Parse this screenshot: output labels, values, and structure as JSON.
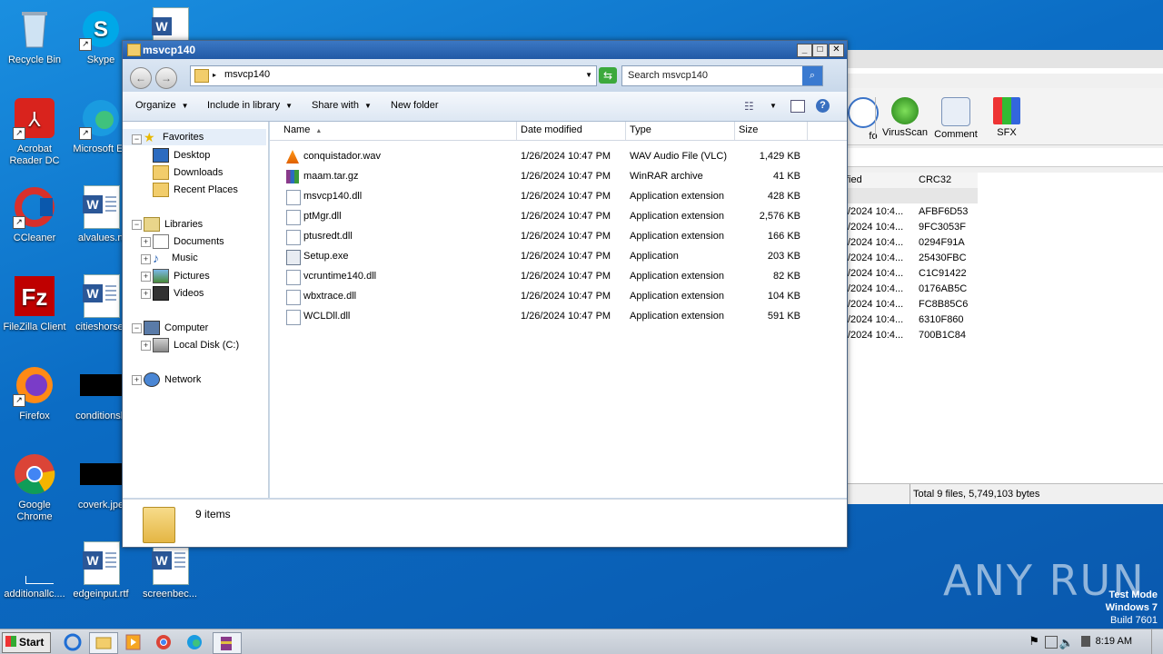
{
  "desktop": {
    "icons": [
      {
        "label": "Recycle Bin"
      },
      {
        "label": "Skype"
      },
      {
        "label": "Acrobat Reader DC"
      },
      {
        "label": "Microsoft Ed"
      },
      {
        "label": "CCleaner"
      },
      {
        "label": "alvalues.rt"
      },
      {
        "label": "FileZilla Client"
      },
      {
        "label": "citieshorse."
      },
      {
        "label": "Firefox"
      },
      {
        "label": "conditionsh"
      },
      {
        "label": "Google Chrome"
      },
      {
        "label": "coverk.jpe"
      },
      {
        "label": "additionallc...."
      },
      {
        "label": "edgeinput.rtf"
      },
      {
        "label": "screenbec..."
      }
    ]
  },
  "background_window": {
    "toolbar": [
      {
        "label": "fo"
      },
      {
        "label": "VirusScan"
      },
      {
        "label": "Comment"
      },
      {
        "label": "SFX"
      }
    ],
    "columns": [
      "fied",
      "CRC32"
    ],
    "rows": [
      {
        "date": "/2024 10:4...",
        "crc": "AFBF6D53"
      },
      {
        "date": "/2024 10:4...",
        "crc": "9FC3053F"
      },
      {
        "date": "/2024 10:4...",
        "crc": "0294F91A"
      },
      {
        "date": "/2024 10:4...",
        "crc": "25430FBC"
      },
      {
        "date": "/2024 10:4...",
        "crc": "C1C91422"
      },
      {
        "date": "/2024 10:4...",
        "crc": "0176AB5C"
      },
      {
        "date": "/2024 10:4...",
        "crc": "FC8B85C6"
      },
      {
        "date": "/2024 10:4...",
        "crc": "6310F860"
      },
      {
        "date": "/2024 10:4...",
        "crc": "700B1C84"
      }
    ],
    "status": "Total 9 files, 5,749,103 bytes"
  },
  "explorer": {
    "title": "msvcp140",
    "address": "msvcp140",
    "search_placeholder": "Search msvcp140",
    "commands": [
      "Organize",
      "Include in library",
      "Share with",
      "New folder"
    ],
    "nav": {
      "favorites": "Favorites",
      "desktop": "Desktop",
      "downloads": "Downloads",
      "recent": "Recent Places",
      "libraries": "Libraries",
      "documents": "Documents",
      "music": "Music",
      "pictures": "Pictures",
      "videos": "Videos",
      "computer": "Computer",
      "localdisk": "Local Disk (C:)",
      "network": "Network"
    },
    "columns": {
      "name": "Name",
      "date": "Date modified",
      "type": "Type",
      "size": "Size"
    },
    "files": [
      {
        "name": "conquistador.wav",
        "date": "1/26/2024 10:47 PM",
        "type": "WAV Audio File (VLC)",
        "size": "1,429 KB",
        "icon": "vlc-icon"
      },
      {
        "name": "maam.tar.gz",
        "date": "1/26/2024 10:47 PM",
        "type": "WinRAR archive",
        "size": "41 KB",
        "icon": "winrar-icon"
      },
      {
        "name": "msvcp140.dll",
        "date": "1/26/2024 10:47 PM",
        "type": "Application extension",
        "size": "428 KB",
        "icon": "dll-icon"
      },
      {
        "name": "ptMgr.dll",
        "date": "1/26/2024 10:47 PM",
        "type": "Application extension",
        "size": "2,576 KB",
        "icon": "dll-icon"
      },
      {
        "name": "ptusredt.dll",
        "date": "1/26/2024 10:47 PM",
        "type": "Application extension",
        "size": "166 KB",
        "icon": "dll-icon"
      },
      {
        "name": "Setup.exe",
        "date": "1/26/2024 10:47 PM",
        "type": "Application",
        "size": "203 KB",
        "icon": "exe-icon"
      },
      {
        "name": "vcruntime140.dll",
        "date": "1/26/2024 10:47 PM",
        "type": "Application extension",
        "size": "82 KB",
        "icon": "dll-icon"
      },
      {
        "name": "wbxtrace.dll",
        "date": "1/26/2024 10:47 PM",
        "type": "Application extension",
        "size": "104 KB",
        "icon": "dll-icon"
      },
      {
        "name": "WCLDll.dll",
        "date": "1/26/2024 10:47 PM",
        "type": "Application extension",
        "size": "591 KB",
        "icon": "dll-icon"
      }
    ],
    "status": "9 items"
  },
  "taskbar": {
    "start": "Start",
    "clock": "8:19 AM"
  },
  "watermark": {
    "line1": "Test Mode",
    "line2": "Windows 7",
    "line3": "Build 7601",
    "brand": "ANY RUN"
  }
}
